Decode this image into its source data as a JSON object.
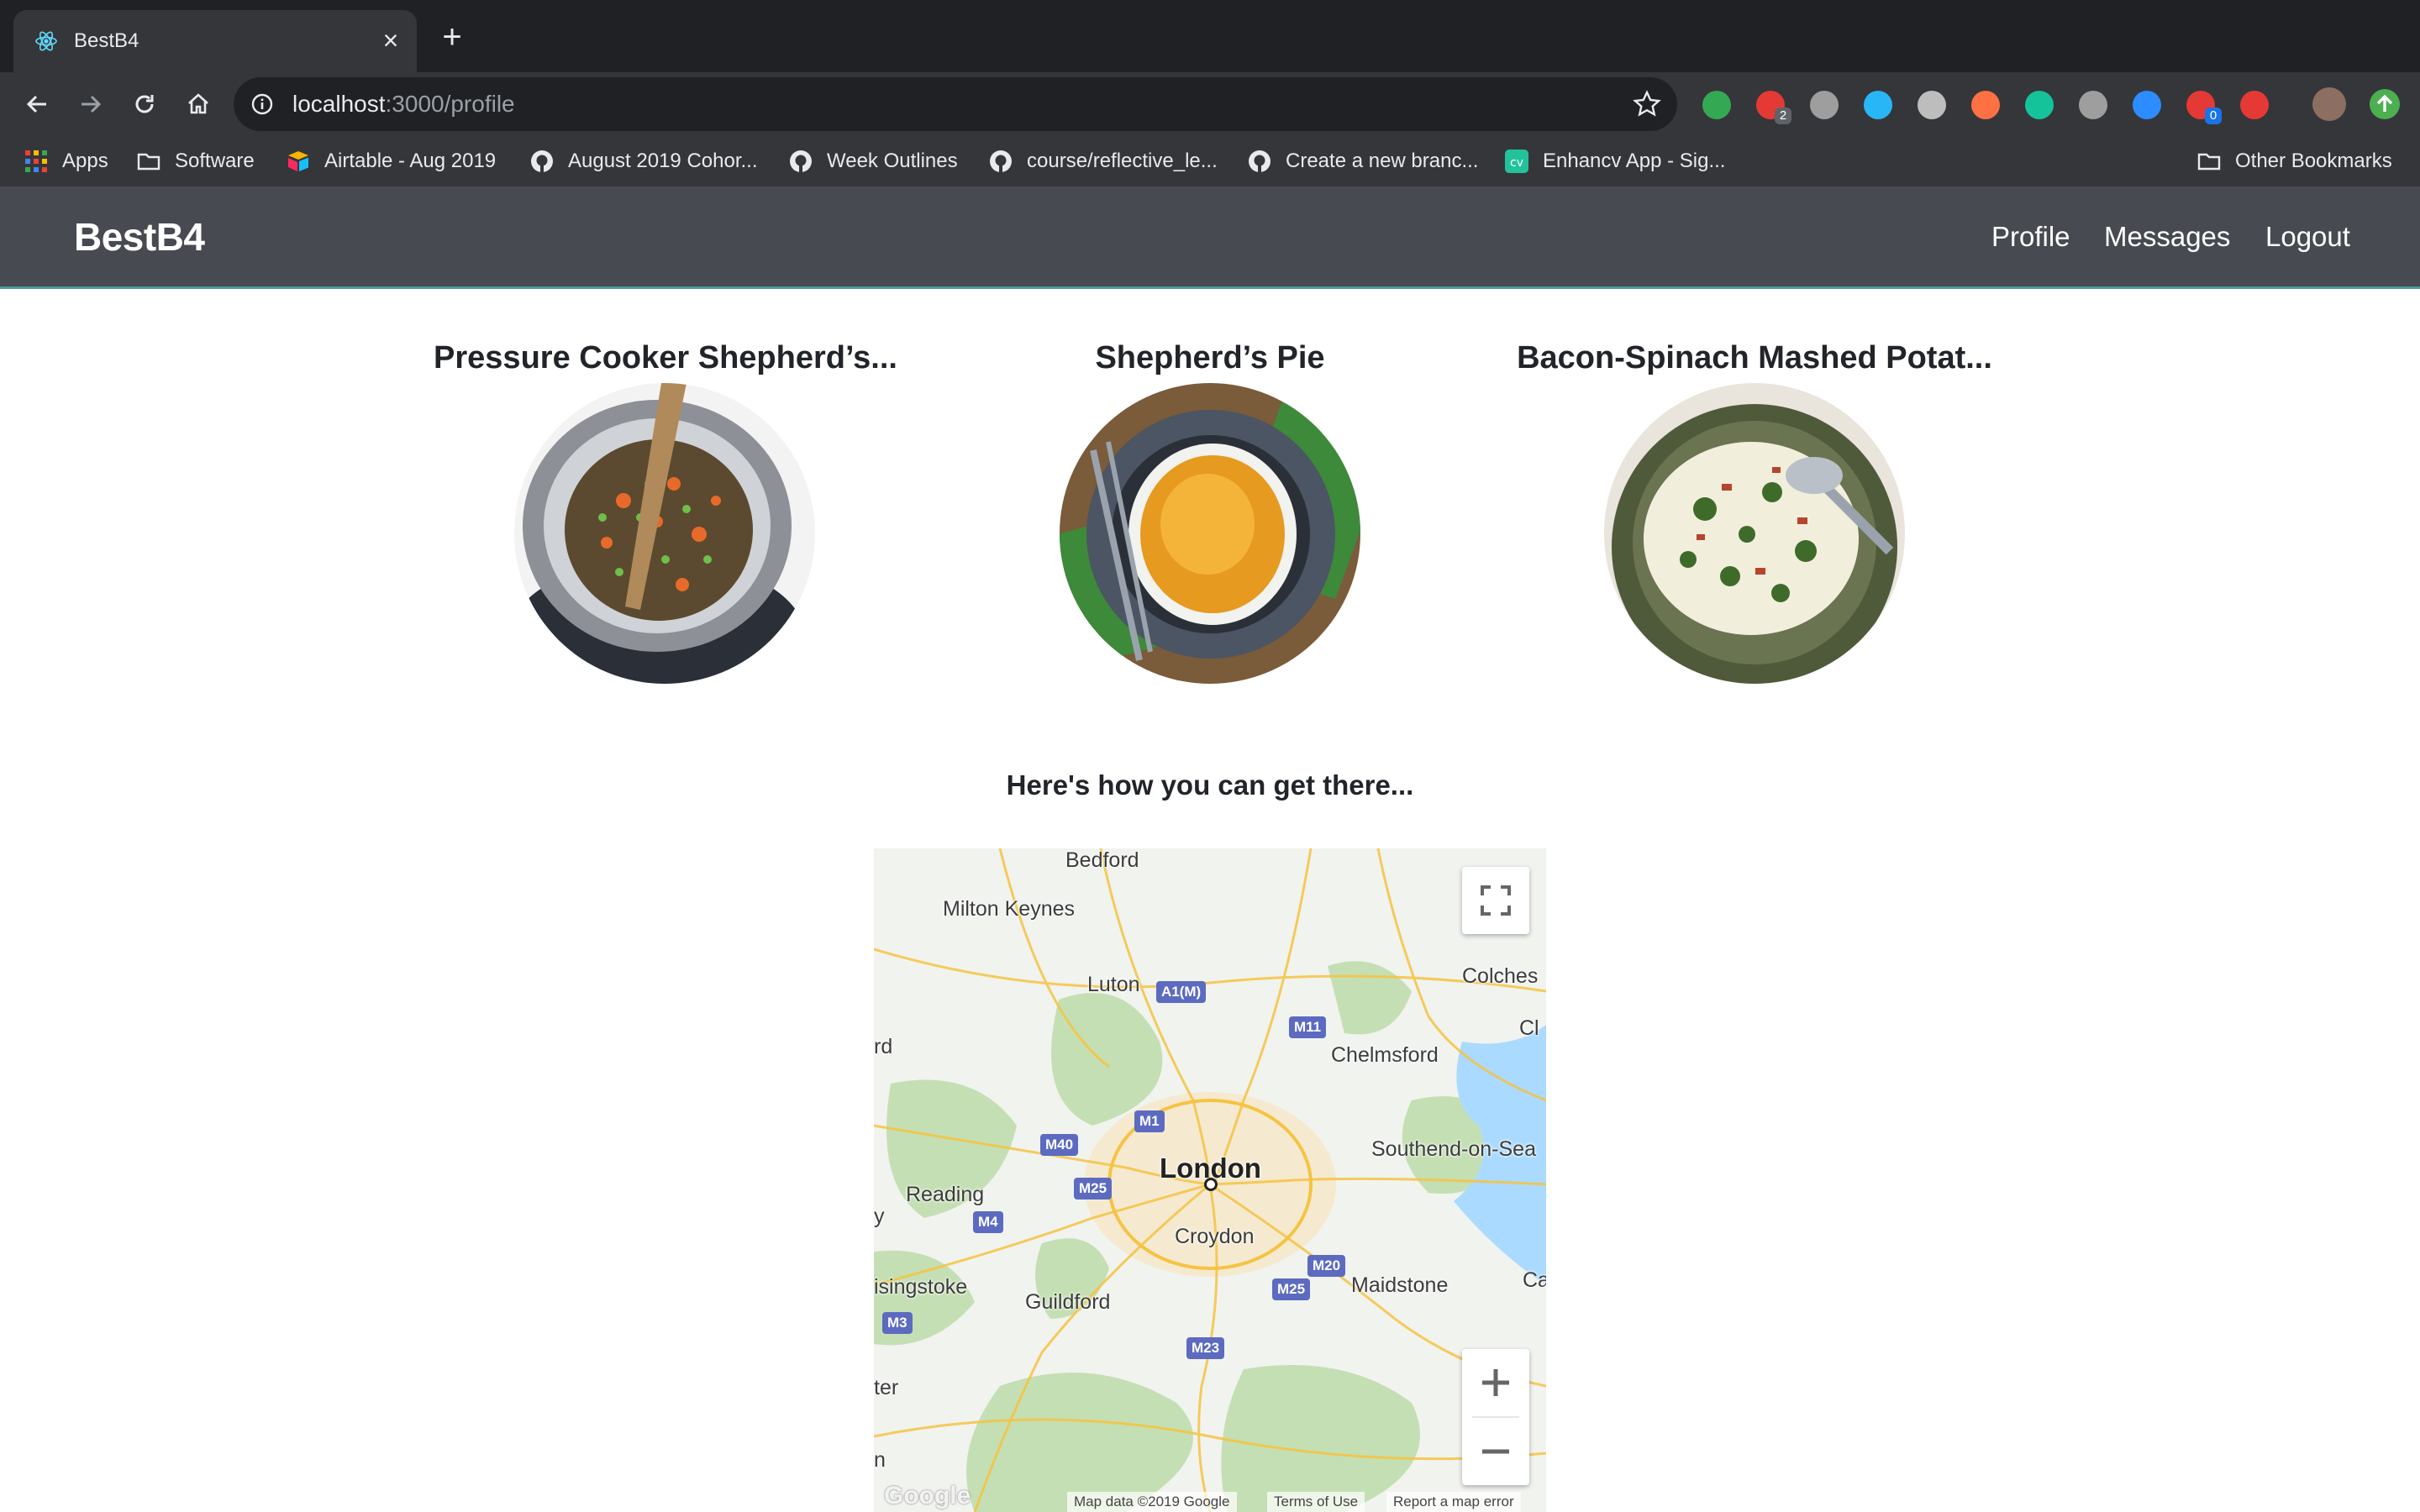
{
  "browser": {
    "tab_title": "BestB4",
    "url_host": "localhost",
    "url_path": ":3000/profile",
    "extensions": [
      {
        "name": "green-check-extension-icon",
        "color": "#34a853"
      },
      {
        "name": "red-extension-icon",
        "color": "#e53935",
        "badge": "2"
      },
      {
        "name": "gray-cloud-extension-icon",
        "color": "#9e9e9e"
      },
      {
        "name": "blue-circle-extension-icon",
        "color": "#29b6f6"
      },
      {
        "name": "gray-square-extension-icon",
        "color": "#bdbdbd"
      },
      {
        "name": "rainbow-extension-icon",
        "color": "#ff7043"
      },
      {
        "name": "grammarly-extension-icon",
        "color": "#15c39a"
      },
      {
        "name": "speech-bubble-extension-icon",
        "color": "#9e9e9e"
      },
      {
        "name": "zoom-extension-icon",
        "color": "#2d8cff"
      },
      {
        "name": "red-badge-extension-icon",
        "color": "#e53935",
        "badge": "0"
      },
      {
        "name": "red-bug-extension-icon",
        "color": "#e53935"
      }
    ],
    "bookmarks": [
      {
        "label": "Apps",
        "icon": "apps-grid-icon"
      },
      {
        "label": "Software",
        "icon": "folder-icon"
      },
      {
        "label": "Airtable - Aug 2019",
        "icon": "airtable-icon"
      },
      {
        "label": "August 2019 Cohor...",
        "icon": "github-icon"
      },
      {
        "label": "Week Outlines",
        "icon": "github-icon"
      },
      {
        "label": "course/reflective_le...",
        "icon": "github-icon"
      },
      {
        "label": "Create a new branc...",
        "icon": "github-icon"
      },
      {
        "label": "Enhancv App - Sig...",
        "icon": "enhancv-icon"
      }
    ],
    "other_bookmarks": "Other Bookmarks"
  },
  "app": {
    "brand": "BestB4",
    "nav": {
      "profile": "Profile",
      "messages": "Messages",
      "logout": "Logout"
    },
    "recipes": [
      {
        "title": "Pressure Cooker Shepherd’s..."
      },
      {
        "title": "Shepherd’s Pie"
      },
      {
        "title": "Bacon-Spinach Mashed Potat..."
      }
    ],
    "directions_heading": "Here's how you can get there...",
    "map": {
      "places": [
        "Bedford",
        "Milton Keynes",
        "Luton",
        "Colches",
        "Cl",
        "rd",
        "Chelmsford",
        "London",
        "Southend-on-Sea",
        "Reading",
        "y",
        "Croydon",
        "isingstoke",
        "Guildford",
        "Maidstone",
        "Ca",
        "ter",
        "n"
      ],
      "roads": [
        "A1(M)",
        "M11",
        "M1",
        "M40",
        "M25",
        "M4",
        "M20",
        "M25",
        "M3",
        "M23"
      ],
      "footer": {
        "logo": "Google",
        "map_data": "Map data ©2019 Google",
        "terms": "Terms of Use",
        "report": "Report a map error"
      }
    }
  }
}
